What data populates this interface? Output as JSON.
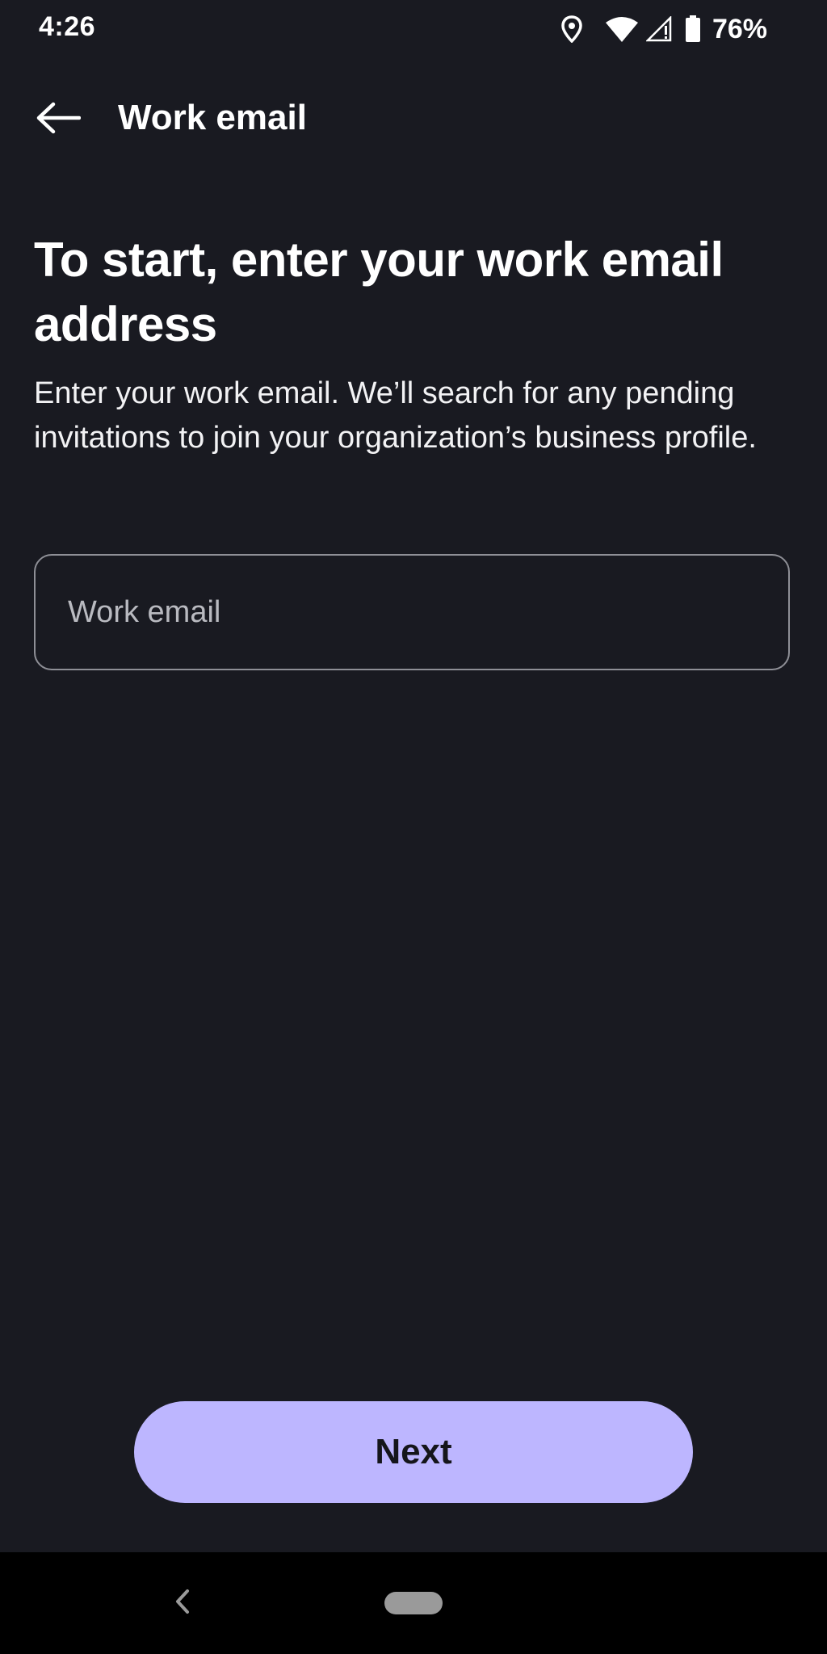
{
  "status_bar": {
    "time": "4:26",
    "battery_percent": "76%",
    "icons": [
      "location-icon",
      "wifi-icon",
      "signal-icon",
      "battery-icon"
    ]
  },
  "app_bar": {
    "back_icon": "arrow-left-icon",
    "title": "Work email"
  },
  "content": {
    "headline": "To start, enter your work email address",
    "description": "Enter your work email. We’ll search for any pending invitations to join your organization’s business profile.",
    "email_input": {
      "placeholder": "Work email",
      "value": ""
    }
  },
  "actions": {
    "next_label": "Next"
  },
  "nav_bar": {
    "back_icon": "chevron-left-icon",
    "home_icon": "home-pill-icon"
  },
  "colors": {
    "background": "#191a21",
    "accent": "#bdb6ff",
    "field_border": "#8e8f96",
    "nav_background": "#000000"
  }
}
